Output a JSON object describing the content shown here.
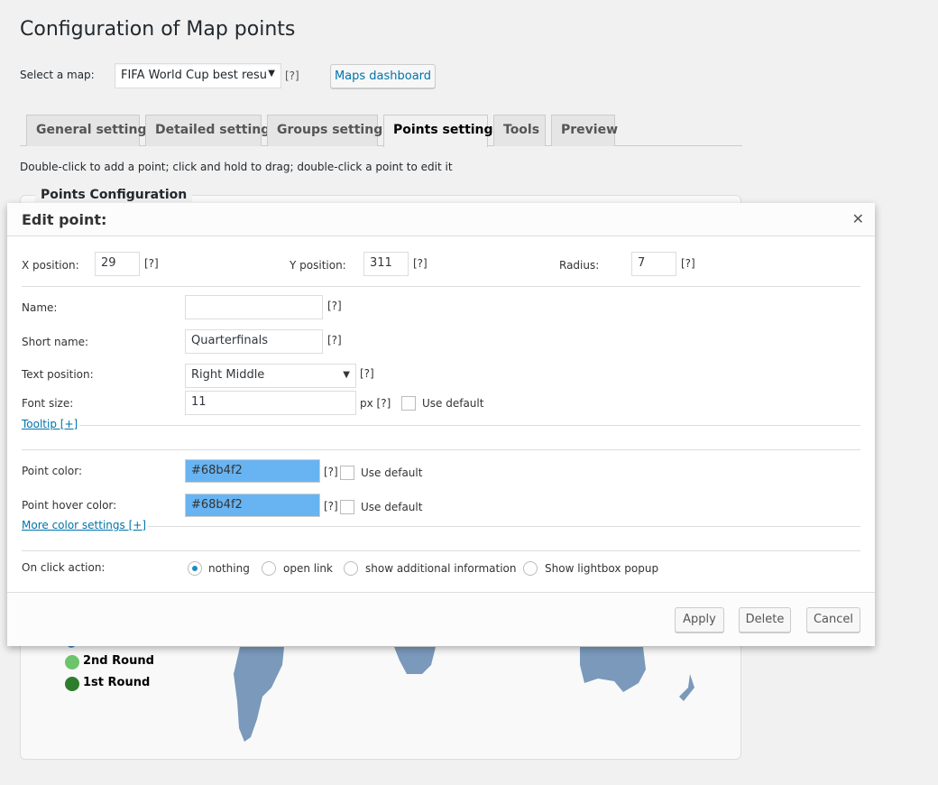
{
  "page": {
    "title": "Configuration of Map points",
    "instruction": "Double-click to add a point; click and hold to drag; double-click a point to edit it"
  },
  "map_select": {
    "label": "Select a map:",
    "value": "FIFA World Cup best resu",
    "help": "[?]",
    "dashboard_button": "Maps dashboard"
  },
  "tabs": [
    {
      "label": "General settings"
    },
    {
      "label": "Detailed settings"
    },
    {
      "label": "Groups settings"
    },
    {
      "label": "Points settings",
      "active": true
    },
    {
      "label": "Tools"
    },
    {
      "label": "Preview"
    }
  ],
  "panel": {
    "title": "Points Configuration",
    "legend": [
      {
        "label": "2nd Round",
        "color": "#6cc46a"
      },
      {
        "label": "1st Round",
        "color": "#2e7d2e"
      }
    ],
    "map_color": "#7a99bb"
  },
  "dialog": {
    "title": "Edit point:",
    "close_icon": "close-icon",
    "x_label": "X position:",
    "x_value": "29",
    "y_label": "Y position:",
    "y_value": "311",
    "r_label": "Radius:",
    "r_value": "7",
    "help": "[?]",
    "name_label": "Name:",
    "name_value": "",
    "short_label": "Short name:",
    "short_value": "Quarterfinals",
    "textpos_label": "Text position:",
    "textpos_value": "Right Middle",
    "font_label": "Font size:",
    "font_value": "11",
    "font_unit": "px [?]",
    "use_default": "Use default",
    "tooltip_link": "Tooltip [+]",
    "color_label": "Point color:",
    "color_value": "#68b4f2",
    "hover_label": "Point hover color:",
    "hover_value": "#68b4f2",
    "more_colors_link": "More color settings [+]",
    "click_label": "On click action:",
    "click_options": [
      "nothing",
      "open link",
      "show additional information",
      "Show lightbox popup"
    ],
    "click_selected": "nothing",
    "apply": "Apply",
    "delete": "Delete",
    "cancel": "Cancel"
  }
}
